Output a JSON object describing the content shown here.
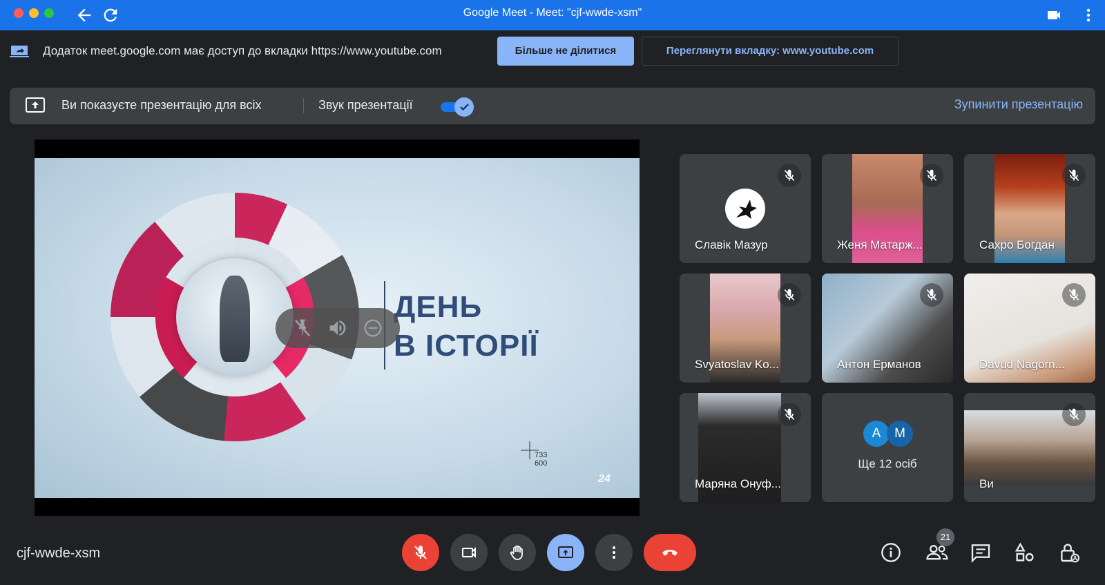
{
  "window": {
    "title": "Google Meet - Meet: \"cjf-wwde-xsm\""
  },
  "share_notice": {
    "text": "Додаток meet.google.com має доступ до вкладки https://www.youtube.com",
    "stop_label": "Більше не ділитися",
    "view_label": "Переглянути вкладку: www.youtube.com"
  },
  "presenting": {
    "text": "Ви показуєте презентацію для всіх",
    "sound_label": "Звук презентації",
    "sound_on": true,
    "stop_label": "Зупинити презентацію"
  },
  "slide": {
    "title_line1": "ДЕНЬ",
    "title_line2": "В ІСТОРІЇ",
    "coords_x": "733",
    "coords_y": "600",
    "channel_logo": "24"
  },
  "participants": [
    {
      "name": "Славік Мазур",
      "muted": true
    },
    {
      "name": "Женя Матарж...",
      "muted": true
    },
    {
      "name": "Сахро Богдан",
      "muted": true
    },
    {
      "name": "Svyatoslav Ko...",
      "muted": true
    },
    {
      "name": "Антон Ерманов",
      "muted": true
    },
    {
      "name": "Davud Nagorn...",
      "muted": true
    },
    {
      "name": "Маряна Онуф...",
      "muted": true
    },
    {
      "name": "Ви",
      "muted": true
    }
  ],
  "more_tile": {
    "avatar1": "A",
    "avatar2": "M",
    "text": "Ще 12 осіб"
  },
  "bottom": {
    "meeting_code": "cjf-wwde-xsm",
    "people_count": "21"
  },
  "colors": {
    "titlebar": "#1a73e8",
    "accent": "#8ab4f8",
    "danger": "#ea4335",
    "surface": "#3c4043",
    "background": "#202124"
  }
}
